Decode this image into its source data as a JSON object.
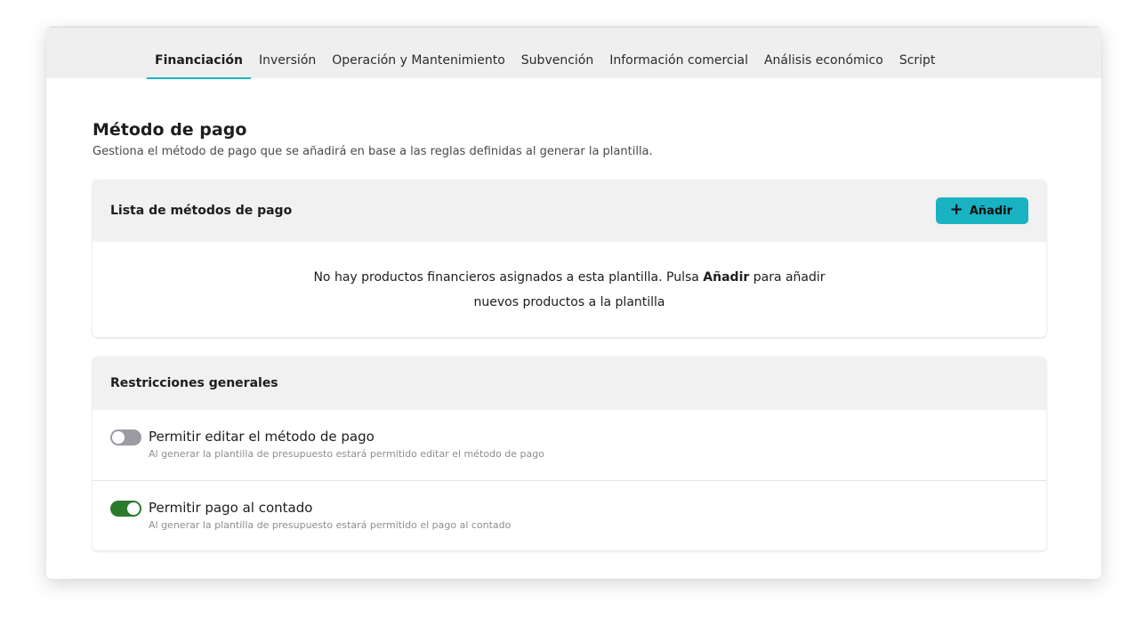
{
  "tabs": [
    {
      "label": "Financiación",
      "active": true
    },
    {
      "label": "Inversión",
      "active": false
    },
    {
      "label": "Operación y Mantenimiento",
      "active": false
    },
    {
      "label": "Subvención",
      "active": false
    },
    {
      "label": "Información comercial",
      "active": false
    },
    {
      "label": "Análisis económico",
      "active": false
    },
    {
      "label": "Script",
      "active": false
    }
  ],
  "page": {
    "title": "Método de pago",
    "subtitle": "Gestiona el método de pago que se añadirá en base a las reglas definidas al generar la plantilla."
  },
  "payment_methods": {
    "title": "Lista de métodos de pago",
    "add_label": "Añadir",
    "add_icon": "plus-icon",
    "empty_before": "No hay productos financieros asignados a esta plantilla. Pulsa ",
    "empty_bold": "Añadir",
    "empty_after_line1": " para añadir",
    "empty_line2": "nuevos productos a la plantilla"
  },
  "restrictions": {
    "title": "Restricciones generales",
    "items": [
      {
        "label": "Permitir editar el método de pago",
        "description": "Al generar la plantilla de presupuesto estará permitido editar el método de pago",
        "enabled": false
      },
      {
        "label": "Permitir pago al contado",
        "description": "Al generar la plantilla de presupuesto estará permitido el pago al contado",
        "enabled": true
      }
    ]
  },
  "colors": {
    "accent": "#19b2c2",
    "toggle_on": "#2c7a2c",
    "toggle_off": "#9b9ba3",
    "header_bg": "#f1f1f2"
  }
}
